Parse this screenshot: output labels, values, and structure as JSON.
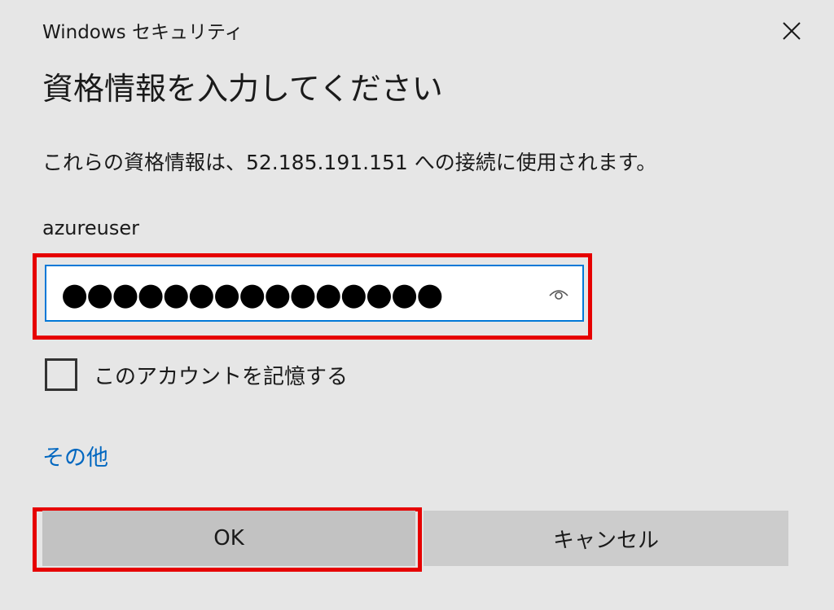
{
  "window": {
    "title": "Windows セキュリティ",
    "close_icon": "close-icon"
  },
  "dialog": {
    "heading": "資格情報を入力してください",
    "description": "これらの資格情報は、52.185.191.151 への接続に使用されます。",
    "username": "azureuser",
    "password": {
      "masked_value": "●●●●●●●●●●●●●●●",
      "reveal_icon": "eye-icon"
    },
    "remember_checkbox": {
      "label": "このアカウントを記憶する",
      "checked": false
    },
    "more_choices_link": "その他",
    "buttons": {
      "ok": "OK",
      "cancel": "キャンセル"
    }
  },
  "colors": {
    "background": "#e6e6e6",
    "accent": "#0078d7",
    "link": "#0067c0",
    "highlight": "#e60000",
    "button": "#cccccc"
  }
}
